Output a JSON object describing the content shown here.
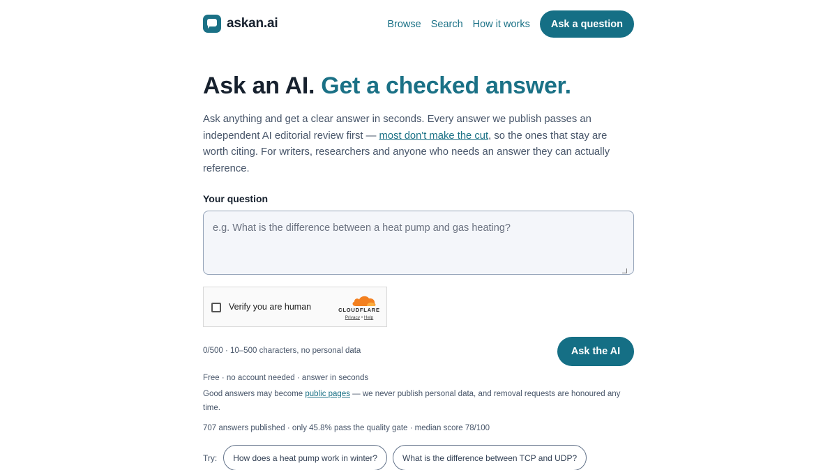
{
  "header": {
    "logo_text": "askan.ai",
    "nav": [
      {
        "label": "Browse"
      },
      {
        "label": "Search"
      },
      {
        "label": "How it works"
      }
    ],
    "cta_label": "Ask a question"
  },
  "hero": {
    "title_main": "Ask an AI.",
    "title_accent": "Get a checked answer.",
    "lead_part1": "Ask anything and get a clear answer in seconds. Every answer we publish passes an independent AI editorial review first —",
    "lead_link": "most don't make the cut",
    "lead_part2": ", so the ones that stay are worth citing. For writers, researchers and anyone who needs an answer they can actually reference."
  },
  "form": {
    "label": "Your question",
    "placeholder": "e.g. What is the difference between a heat pump and gas heating?",
    "value": "",
    "counter": "0/500 · 10–500 characters, no personal data",
    "submit_label": "Ask the AI"
  },
  "captcha": {
    "label": "Verify you are human",
    "brand": "CLOUDFLARE",
    "privacy": "Privacy",
    "separator": " • ",
    "help": "Help",
    "brand_color": "#f38020"
  },
  "notes": {
    "free": "Free · no account needed · answer in seconds",
    "public_part1": "Good answers may become",
    "public_link": "public pages",
    "public_part2": "— we never publish personal data, and removal requests are honoured any time.",
    "stats": "707 answers published · only 45.8% pass the quality gate · median score 78/100"
  },
  "try": {
    "label": "Try:",
    "examples": [
      "How does a heat pump work in winter?",
      "What is the difference between TCP and UDP?"
    ]
  },
  "colors": {
    "accent": "#1b7186",
    "text_dark": "#17212e",
    "text_muted": "#475569"
  }
}
